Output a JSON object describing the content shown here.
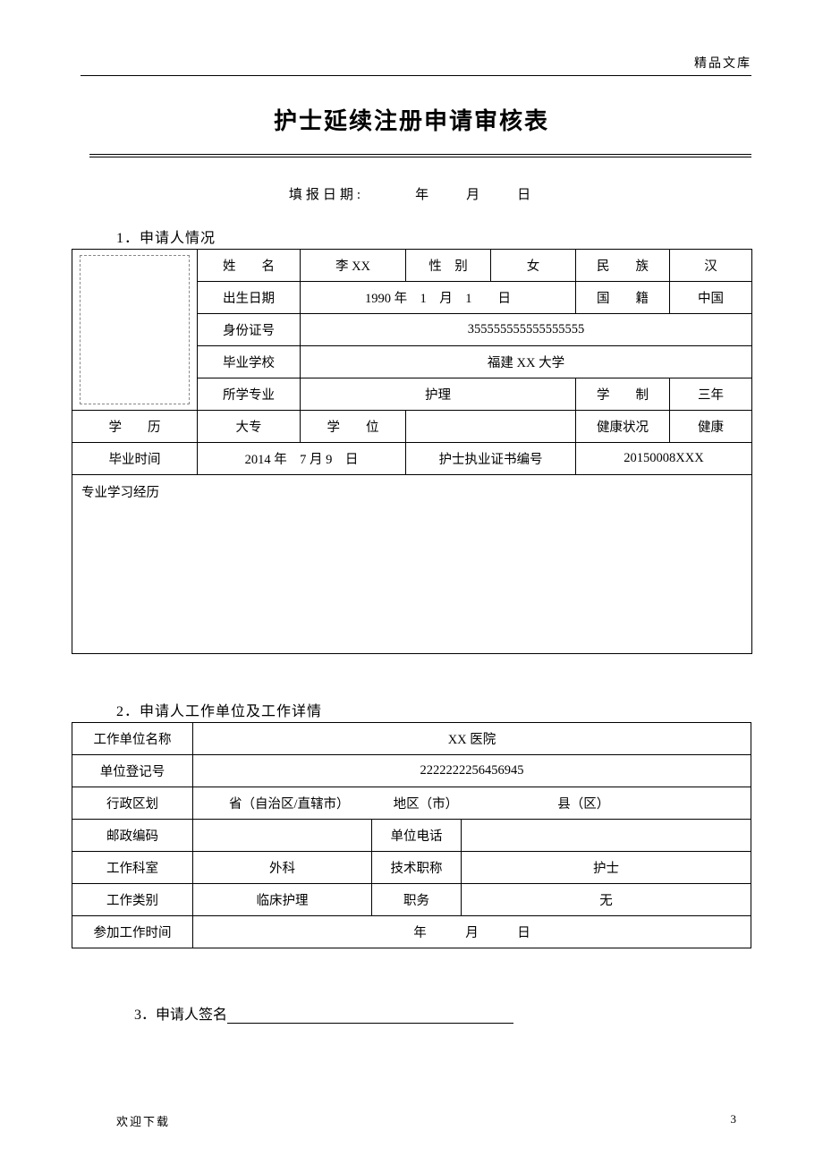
{
  "header": {
    "corner": "精品文库"
  },
  "title": "护士延续注册申请审核表",
  "date_line": "填报日期:　　　年　　月　　日",
  "section1": {
    "heading": "1．申请人情况",
    "labels": {
      "name": "姓　　名",
      "gender": "性　别",
      "ethnic": "民　　族",
      "dob": "出生日期",
      "nationality": "国　　籍",
      "id_no": "身份证号",
      "school": "毕业学校",
      "major": "所学专业",
      "duration": "学　　制",
      "education": "学　　历",
      "degree": "学　　位",
      "health": "健康状况",
      "graduation": "毕业时间",
      "cert_no": "护士执业证书编号",
      "study_history": "专业学习经历"
    },
    "values": {
      "name": "李 XX",
      "gender": "女",
      "ethnic": "汉",
      "dob": "1990 年　1　月　1　　日",
      "nationality": "中国",
      "id_no": "355555555555555555",
      "school": "福建 XX 大学",
      "major": "护理",
      "duration": "三年",
      "education": "大专",
      "degree": "",
      "health": "健康",
      "graduation": "2014 年　7 月 9　日",
      "cert_no": "20150008XXX",
      "study_history": ""
    }
  },
  "section2": {
    "heading": "2．申请人工作单位及工作详情",
    "labels": {
      "unit_name": "工作单位名称",
      "unit_reg": "单位登记号",
      "admin_div": "行政区划",
      "postcode": "邮政编码",
      "unit_phone": "单位电话",
      "dept": "工作科室",
      "tech_title": "技术职称",
      "work_type": "工作类别",
      "position": "职务",
      "start_date": "参加工作时间"
    },
    "values": {
      "unit_name": "XX 医院",
      "unit_reg": "2222222256456945",
      "admin_prov": "省（自治区/直辖市）",
      "admin_city": "地区（市）",
      "admin_county": "县（区）",
      "postcode": "",
      "unit_phone": "",
      "dept": "外科",
      "tech_title": "护士",
      "work_type": "临床护理",
      "position": "无",
      "start_date": "年　　　月　　　日"
    }
  },
  "section3": {
    "heading": "3．申请人签名"
  },
  "footer": {
    "left": "欢迎下载",
    "right": "3"
  }
}
